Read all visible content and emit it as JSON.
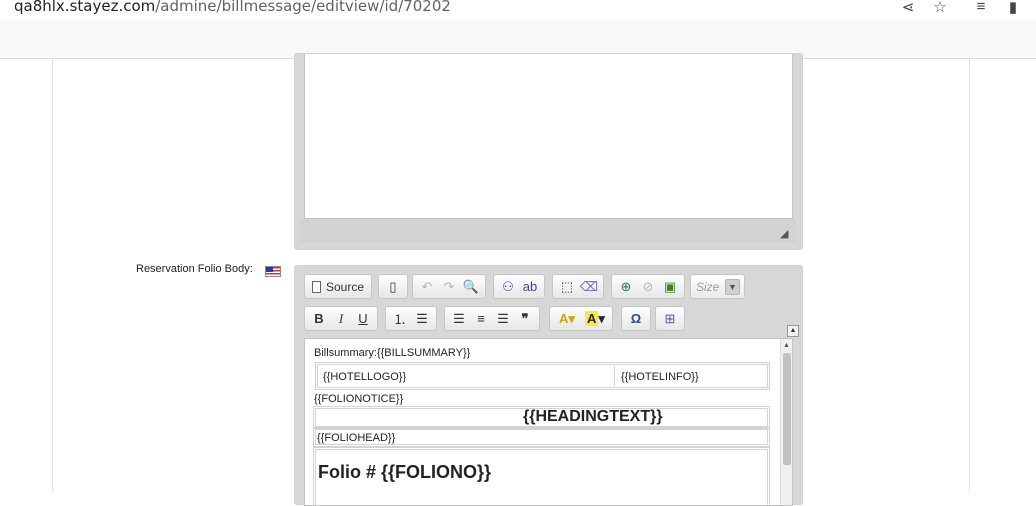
{
  "browser": {
    "url_host": "qa8hlx.stayez.com",
    "url_path": "/admine/billmessage/editview/id/70202",
    "icons": [
      "share-icon",
      "star-icon",
      "reading-list-icon",
      "side-panel-icon",
      "more-icon"
    ]
  },
  "form": {
    "label": "Reservation Folio Body:",
    "flag": "us-flag-icon"
  },
  "toolbar": {
    "source_label": "Source",
    "size_placeholder": "Size"
  },
  "content": {
    "bill_summary": "Billsummary:{{BILLSUMMARY}}",
    "hotel_logo": "{{HOTELLOGO}}",
    "hotel_info": "{{HOTELINFO}}",
    "folio_notice": "{{FOLIONOTICE}}",
    "heading_text": "{{HEADINGTEXT}}",
    "folio_head": "{{FOLIOHEAD}}",
    "folio_no": "Folio # {{FOLIONO}}"
  }
}
